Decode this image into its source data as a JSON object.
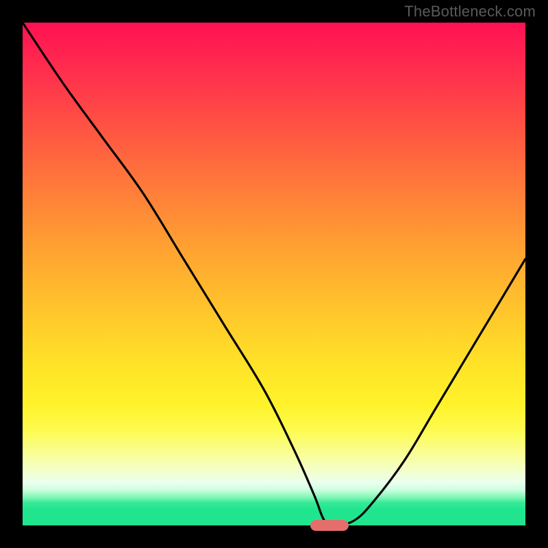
{
  "attribution": "TheBottleneck.com",
  "colors": {
    "page_bg": "#000000",
    "attribution_text": "#5a5a5a",
    "curve_stroke": "#000000",
    "marker_fill": "#e46e6b",
    "gradient_stops": [
      "#ff1153",
      "#ff2f4d",
      "#ff5742",
      "#ff7f39",
      "#ffa531",
      "#ffc72b",
      "#ffe328",
      "#fff22a",
      "#fdfb4f",
      "#fafd8b",
      "#f5ffc0",
      "#eafff0",
      "#c8ffdc",
      "#7bf5b3",
      "#36e998",
      "#1fe58e",
      "#20e58f"
    ]
  },
  "chart_data": {
    "type": "line",
    "title": "",
    "xlabel": "",
    "ylabel": "",
    "xlim": [
      0,
      100
    ],
    "ylim": [
      0,
      100
    ],
    "legend": false,
    "grid": false,
    "series": [
      {
        "name": "bottleneck-curve",
        "x": [
          0,
          8,
          16,
          24,
          32,
          40,
          48,
          54,
          58,
          60,
          62,
          66,
          70,
          76,
          82,
          88,
          94,
          100
        ],
        "y": [
          100,
          88,
          77,
          66,
          53,
          40,
          27,
          15,
          6,
          1,
          0,
          1,
          5,
          13,
          23,
          33,
          43,
          53
        ]
      }
    ],
    "annotations": [
      {
        "type": "marker",
        "shape": "pill",
        "x": 61,
        "y": 0,
        "color": "#e46e6b"
      }
    ]
  }
}
